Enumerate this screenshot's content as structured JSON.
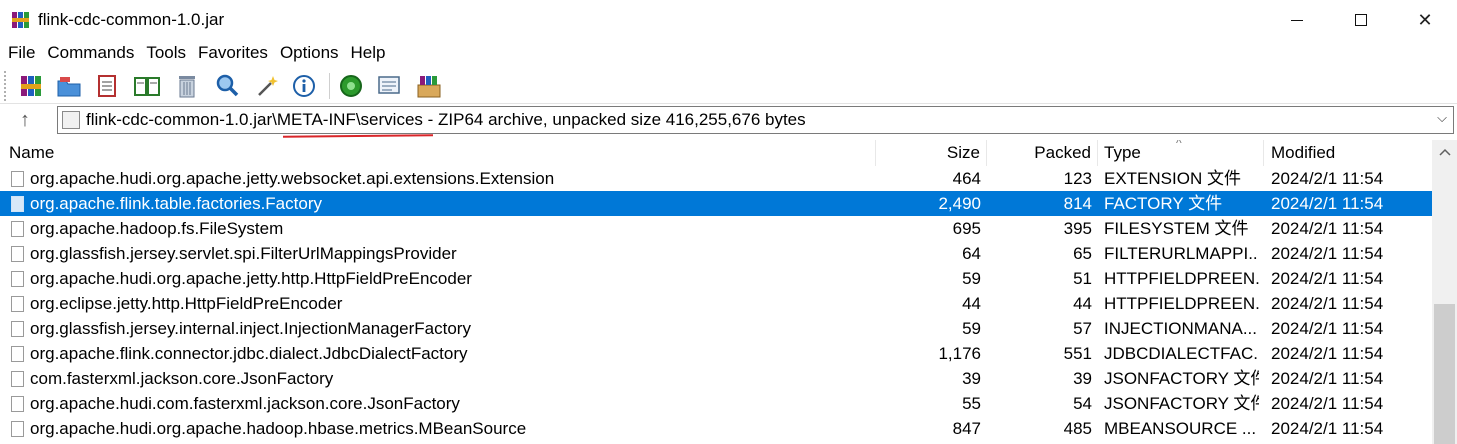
{
  "window": {
    "title": "flink-cdc-common-1.0.jar",
    "app_icon": "winrar-books-icon",
    "controls": {
      "minimize": "minimize-icon",
      "maximize": "maximize-icon",
      "close": "✕"
    }
  },
  "menu": [
    "File",
    "Commands",
    "Tools",
    "Favorites",
    "Options",
    "Help"
  ],
  "toolbar": {
    "buttons": [
      {
        "icon": "add-archive-icon"
      },
      {
        "icon": "extract-to-icon"
      },
      {
        "icon": "test-icon"
      },
      {
        "icon": "view-icon"
      },
      {
        "icon": "delete-icon"
      },
      {
        "icon": "find-icon"
      },
      {
        "icon": "wizard-icon"
      },
      {
        "icon": "info-icon"
      },
      {
        "icon": "virus-scan-icon"
      },
      {
        "icon": "comment-icon"
      },
      {
        "icon": "sfx-icon"
      }
    ]
  },
  "address": {
    "path": "flink-cdc-common-1.0.jar\\META-INF\\services - ZIP64 archive, unpacked size 416,255,676 bytes",
    "up_icon": "↑",
    "dropdown_icon": "⌵"
  },
  "columns": {
    "name": "Name",
    "size": "Size",
    "packed": "Packed",
    "type": "Type",
    "modified": "Modified",
    "sort_caret": "^"
  },
  "rows": [
    {
      "name": "org.apache.hudi.org.apache.jetty.websocket.api.extensions.Extension",
      "size": "464",
      "packed": "123",
      "type": "EXTENSION 文件",
      "modified": "2024/2/1 11:54",
      "selected": false
    },
    {
      "name": "org.apache.flink.table.factories.Factory",
      "size": "2,490",
      "packed": "814",
      "type": "FACTORY 文件",
      "modified": "2024/2/1 11:54",
      "selected": true
    },
    {
      "name": "org.apache.hadoop.fs.FileSystem",
      "size": "695",
      "packed": "395",
      "type": "FILESYSTEM 文件",
      "modified": "2024/2/1 11:54",
      "selected": false
    },
    {
      "name": "org.glassfish.jersey.servlet.spi.FilterUrlMappingsProvider",
      "size": "64",
      "packed": "65",
      "type": "FILTERURLMAPPI...",
      "modified": "2024/2/1 11:54",
      "selected": false
    },
    {
      "name": "org.apache.hudi.org.apache.jetty.http.HttpFieldPreEncoder",
      "size": "59",
      "packed": "51",
      "type": "HTTPFIELDPREEN...",
      "modified": "2024/2/1 11:54",
      "selected": false
    },
    {
      "name": "org.eclipse.jetty.http.HttpFieldPreEncoder",
      "size": "44",
      "packed": "44",
      "type": "HTTPFIELDPREEN...",
      "modified": "2024/2/1 11:54",
      "selected": false
    },
    {
      "name": "org.glassfish.jersey.internal.inject.InjectionManagerFactory",
      "size": "59",
      "packed": "57",
      "type": "INJECTIONMANA...",
      "modified": "2024/2/1 11:54",
      "selected": false
    },
    {
      "name": "org.apache.flink.connector.jdbc.dialect.JdbcDialectFactory",
      "size": "1,176",
      "packed": "551",
      "type": "JDBCDIALECTFAC...",
      "modified": "2024/2/1 11:54",
      "selected": false
    },
    {
      "name": "com.fasterxml.jackson.core.JsonFactory",
      "size": "39",
      "packed": "39",
      "type": "JSONFACTORY 文件",
      "modified": "2024/2/1 11:54",
      "selected": false
    },
    {
      "name": "org.apache.hudi.com.fasterxml.jackson.core.JsonFactory",
      "size": "55",
      "packed": "54",
      "type": "JSONFACTORY 文件",
      "modified": "2024/2/1 11:54",
      "selected": false
    },
    {
      "name": "org.apache.hudi.org.apache.hadoop.hbase.metrics.MBeanSource",
      "size": "847",
      "packed": "485",
      "type": "MBEANSOURCE ...",
      "modified": "2024/2/1 11:54",
      "selected": false
    }
  ],
  "colors": {
    "selection": "#0078d7",
    "annotation_underline": "#d9262a"
  }
}
